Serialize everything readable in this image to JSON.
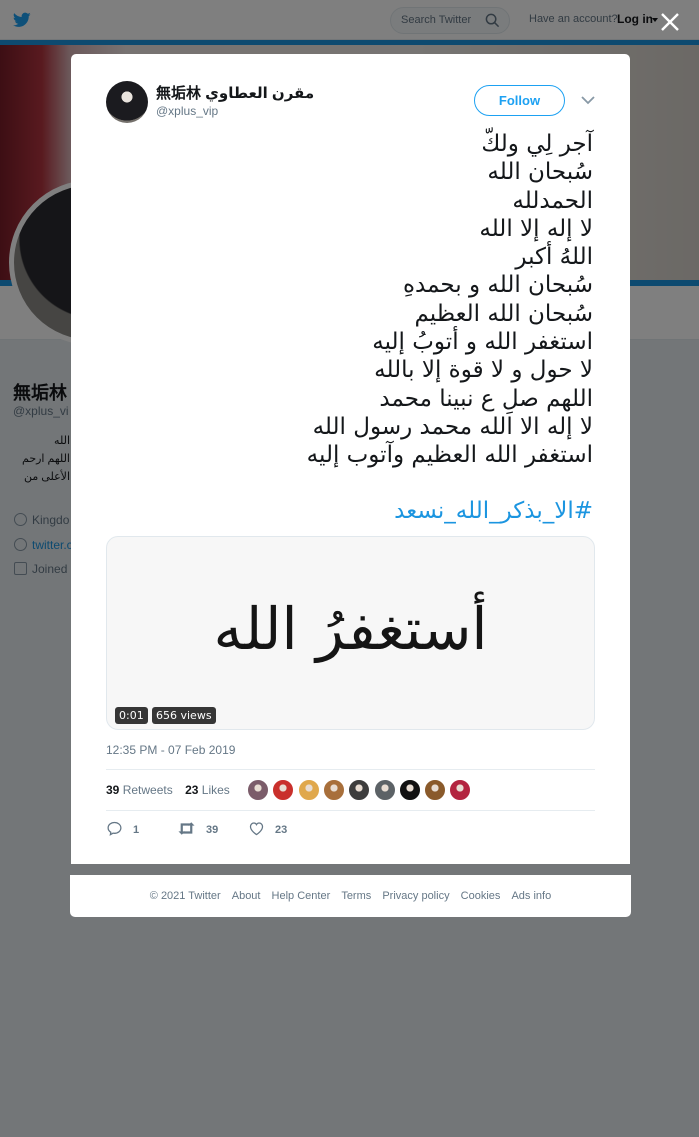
{
  "topbar": {
    "search_placeholder": "Search Twitter",
    "have_account": "Have an account?",
    "login_label": "Log in"
  },
  "background_profile": {
    "name_partial": "無垢林",
    "handle_partial": "@xplus_vi",
    "bio_lines": [
      "الله",
      "اللهم ارحم",
      "الأعلى من"
    ],
    "location_partial": "Kingdo",
    "link_partial": "twitter.c",
    "joined_partial": "Joined"
  },
  "tweet": {
    "display_name": "無垢林 مقرن العطاوي",
    "handle": "@xplus_vip",
    "follow_label": "Follow",
    "lines": [
      "آجر لِي ولكّ",
      "سُبحان الله",
      "الحمدلله",
      "لا إله إلا الله",
      "اللهُ أكبر",
      "سُبحان الله و بحمدهِ",
      "سُبحان الله العظيم",
      "استغفر الله و أتوبُ إليه",
      "لا حول و لا قوة إلا بالله",
      "اللهم صلِ ع نبينا محمد",
      "لا إله الا الله محمد رسول الله",
      "استغفر الله العظيم وآتوب إليه"
    ],
    "hashtag": "#الا_بذكر_الله_نسعد",
    "media": {
      "calligraphy": "أستغفرُ الله",
      "duration": "0:01",
      "views": "656 views"
    },
    "timestamp": "12:35 PM - 07 Feb 2019",
    "retweets_count": "39",
    "retweets_label": "Retweets",
    "likes_count": "23",
    "likes_label": "Likes",
    "likers": [
      "#7b5c6a",
      "#c9302c",
      "#e0a84c",
      "#a86f3b",
      "#3d3d3d",
      "#5c6266",
      "#111111",
      "#8a5a2b",
      "#b3243f"
    ],
    "actions": {
      "replies": "1",
      "retweets": "39",
      "likes": "23"
    }
  },
  "footer": {
    "copyright": "© 2021 Twitter",
    "links": [
      "About",
      "Help Center",
      "Terms",
      "Privacy policy",
      "Cookies",
      "Ads info"
    ]
  },
  "colors": {
    "accent": "#1da1f2",
    "link": "#1b95e0",
    "muted": "#657786"
  }
}
